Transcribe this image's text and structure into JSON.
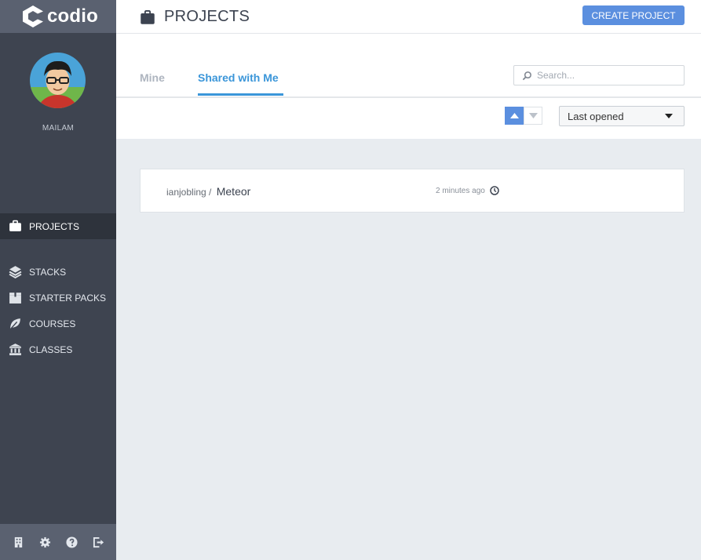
{
  "app": {
    "logo_text": "codio"
  },
  "user": {
    "name": "MAILAM"
  },
  "sidebar": {
    "items": [
      {
        "label": "PROJECTS",
        "icon": "briefcase-icon",
        "active": true
      },
      {
        "label": "STACKS",
        "icon": "layers-icon",
        "active": false
      },
      {
        "label": "STARTER PACKS",
        "icon": "box-icon",
        "active": false
      },
      {
        "label": "COURSES",
        "icon": "leaf-icon",
        "active": false
      },
      {
        "label": "CLASSES",
        "icon": "institution-icon",
        "active": false
      }
    ],
    "footer_icons": [
      "building-icon",
      "gear-icon",
      "help-icon",
      "sign-out-icon"
    ]
  },
  "header": {
    "title": "PROJECTS",
    "title_icon": "briefcase-icon",
    "create_button": "CREATE PROJECT"
  },
  "tabs": [
    {
      "label": "Mine",
      "active": false
    },
    {
      "label": "Shared with Me",
      "active": true
    }
  ],
  "search": {
    "placeholder": "Search...",
    "value": ""
  },
  "sort": {
    "direction": "ascending",
    "selected": "Last opened"
  },
  "projects": [
    {
      "owner": "ianjobling",
      "separator": " / ",
      "name": "Meteor",
      "time": "2 minutes ago"
    }
  ],
  "colors": {
    "sidebar_bg": "#3e4450",
    "accent_blue": "#5b8fdf",
    "tab_active": "#3b96d9",
    "content_bg": "#e8ecf0"
  }
}
